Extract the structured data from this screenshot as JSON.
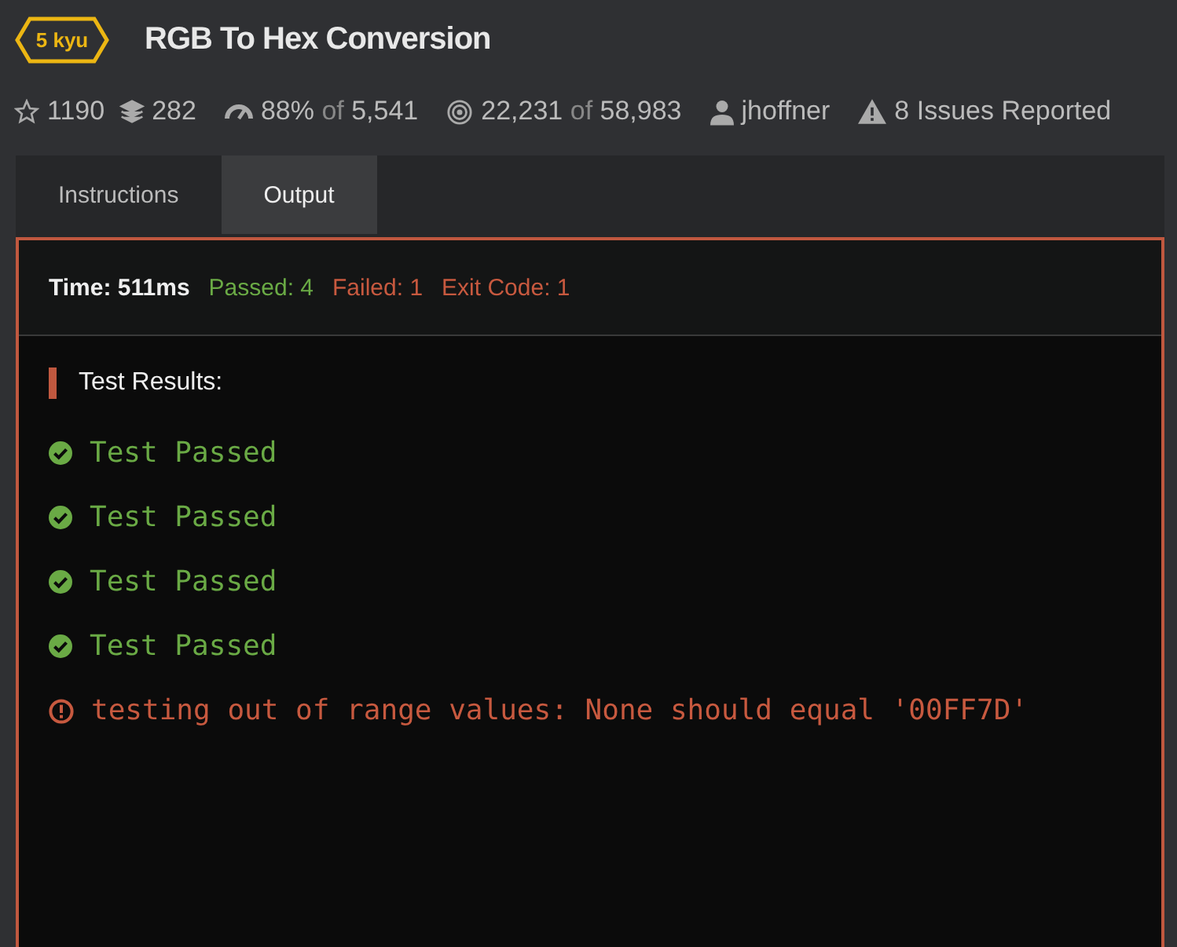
{
  "kata": {
    "rank": "5 kyu",
    "title": "RGB To Hex Conversion"
  },
  "stats": [
    {
      "kind": "stars",
      "value": "1190"
    },
    {
      "kind": "collections",
      "value": "282"
    },
    {
      "kind": "satisfaction",
      "value": "88%",
      "connector": "of",
      "total": "5,541"
    },
    {
      "kind": "completions",
      "value": "22,231",
      "connector": "of",
      "total": "58,983"
    },
    {
      "kind": "author",
      "value": "jhoffner"
    },
    {
      "kind": "issues",
      "value": "8 Issues Reported"
    }
  ],
  "tabs": [
    {
      "label": "Instructions",
      "selected": false
    },
    {
      "label": "Output",
      "selected": true
    }
  ],
  "summary": [
    {
      "kind": "time",
      "text": "Time: 511ms"
    },
    {
      "kind": "passed",
      "text": "Passed: 4"
    },
    {
      "kind": "failed",
      "text": "Failed: 1"
    },
    {
      "kind": "failed",
      "text": "Exit Code: 1"
    }
  ],
  "results_heading": "Test Results:",
  "results": [
    {
      "kind": "passed",
      "text": "Test Passed"
    },
    {
      "kind": "passed",
      "text": "Test Passed"
    },
    {
      "kind": "passed",
      "text": "Test Passed"
    },
    {
      "kind": "passed",
      "text": "Test Passed"
    },
    {
      "kind": "failed",
      "text": "testing out of range values: None should equal '00FF7D'"
    }
  ]
}
